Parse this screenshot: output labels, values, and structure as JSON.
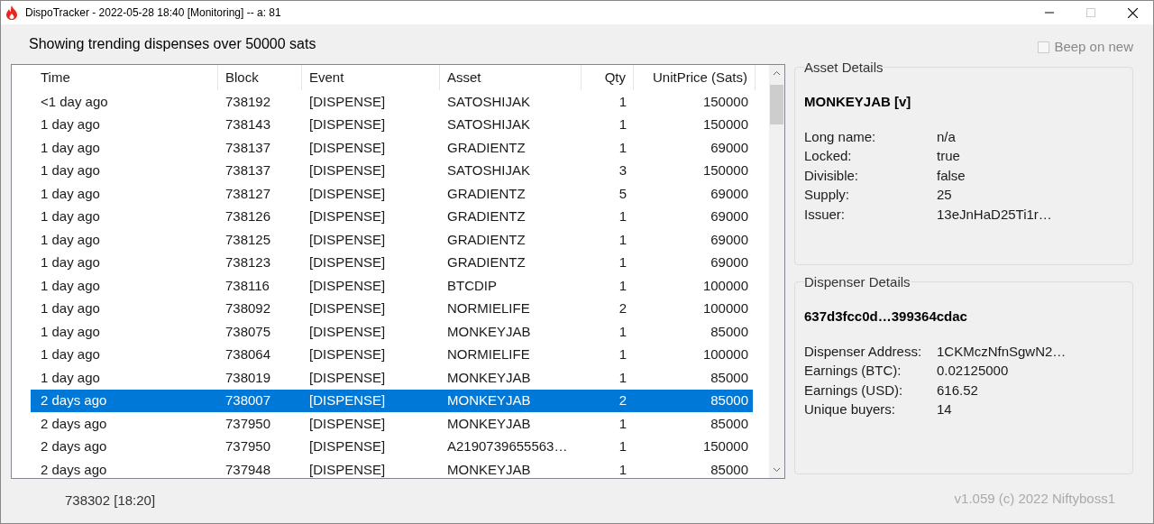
{
  "window": {
    "title": "DispoTracker - 2022-05-28 18:40 [Monitoring] -- a: 81"
  },
  "heading": "Showing trending dispenses over 50000 sats",
  "beep": {
    "label": "Beep on new",
    "checked": false,
    "disabled": true
  },
  "table": {
    "columns": [
      "Time",
      "Block",
      "Event",
      "Asset",
      "Qty",
      "UnitPrice (Sats)"
    ],
    "rows": [
      {
        "cells": [
          "<1 day ago",
          "738192",
          "[DISPENSE]",
          "SATOSHIJAK",
          "1",
          "150000"
        ],
        "selected": false
      },
      {
        "cells": [
          "1 day ago",
          "738143",
          "[DISPENSE]",
          "SATOSHIJAK",
          "1",
          "150000"
        ],
        "selected": false
      },
      {
        "cells": [
          "1 day ago",
          "738137",
          "[DISPENSE]",
          "GRADIENTZ",
          "1",
          "69000"
        ],
        "selected": false
      },
      {
        "cells": [
          "1 day ago",
          "738137",
          "[DISPENSE]",
          "SATOSHIJAK",
          "3",
          "150000"
        ],
        "selected": false
      },
      {
        "cells": [
          "1 day ago",
          "738127",
          "[DISPENSE]",
          "GRADIENTZ",
          "5",
          "69000"
        ],
        "selected": false
      },
      {
        "cells": [
          "1 day ago",
          "738126",
          "[DISPENSE]",
          "GRADIENTZ",
          "1",
          "69000"
        ],
        "selected": false
      },
      {
        "cells": [
          "1 day ago",
          "738125",
          "[DISPENSE]",
          "GRADIENTZ",
          "1",
          "69000"
        ],
        "selected": false
      },
      {
        "cells": [
          "1 day ago",
          "738123",
          "[DISPENSE]",
          "GRADIENTZ",
          "1",
          "69000"
        ],
        "selected": false
      },
      {
        "cells": [
          "1 day ago",
          "738116",
          "[DISPENSE]",
          "BTCDIP",
          "1",
          "100000"
        ],
        "selected": false
      },
      {
        "cells": [
          "1 day ago",
          "738092",
          "[DISPENSE]",
          "NORMIELIFE",
          "2",
          "100000"
        ],
        "selected": false
      },
      {
        "cells": [
          "1 day ago",
          "738075",
          "[DISPENSE]",
          "MONKEYJAB",
          "1",
          "85000"
        ],
        "selected": false
      },
      {
        "cells": [
          "1 day ago",
          "738064",
          "[DISPENSE]",
          "NORMIELIFE",
          "1",
          "100000"
        ],
        "selected": false
      },
      {
        "cells": [
          "1 day ago",
          "738019",
          "[DISPENSE]",
          "MONKEYJAB",
          "1",
          "85000"
        ],
        "selected": false
      },
      {
        "cells": [
          "2 days ago",
          "738007",
          "[DISPENSE]",
          "MONKEYJAB",
          "2",
          "85000"
        ],
        "selected": true
      },
      {
        "cells": [
          "2 days ago",
          "737950",
          "[DISPENSE]",
          "MONKEYJAB",
          "1",
          "85000"
        ],
        "selected": false
      },
      {
        "cells": [
          "2 days ago",
          "737950",
          "[DISPENSE]",
          "A2190739655563…",
          "1",
          "150000"
        ],
        "selected": false
      },
      {
        "cells": [
          "2 days ago",
          "737948",
          "[DISPENSE]",
          "MONKEYJAB",
          "1",
          "85000"
        ],
        "selected": false
      }
    ]
  },
  "asset_details": {
    "legend": "Asset Details",
    "name": "MONKEYJAB [v]",
    "fields": [
      {
        "label": "Long name:",
        "value": "n/a"
      },
      {
        "label": "Locked:",
        "value": "true"
      },
      {
        "label": "Divisible:",
        "value": "false"
      },
      {
        "label": "Supply:",
        "value": "25"
      },
      {
        "label": "Issuer:",
        "value": "13eJnHaD25Ti1r…"
      }
    ]
  },
  "dispenser_details": {
    "legend": "Dispenser Details",
    "name": "637d3fcc0d…399364cdac",
    "fields": [
      {
        "label": "Dispenser Address:",
        "value": "1CKMczNfnSgwN2…"
      },
      {
        "label": "Earnings (BTC):",
        "value": "0.02125000"
      },
      {
        "label": "Earnings (USD):",
        "value": "616.52"
      },
      {
        "label": "Unique buyers:",
        "value": "14"
      }
    ]
  },
  "status_bar": {
    "block": "738302 [18:20]",
    "version": "v1.059 (c) 2022 Niftyboss1"
  }
}
